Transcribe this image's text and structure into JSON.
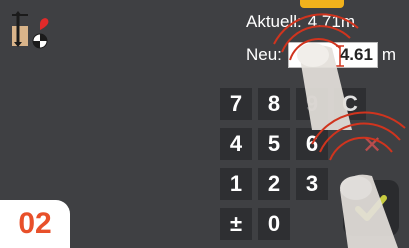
{
  "measure": {
    "current_label": "Aktuell:",
    "current_value": "4.71m",
    "new_label": "Neu:",
    "new_value": "4.61",
    "new_unit": "m"
  },
  "keypad": {
    "keys": [
      "7",
      "8",
      "9",
      "C",
      "4",
      "5",
      "6",
      "1",
      "2",
      "3",
      "±",
      "0"
    ]
  },
  "actions": {
    "cancel_icon": "✕",
    "confirm_icon": "✓"
  },
  "step": {
    "number": "02"
  },
  "colors": {
    "background": "#3f4043",
    "key_background": "#2e2f32",
    "step_number": "#e8502a",
    "cancel": "#b84d4d",
    "confirm": "#c8cc40",
    "touch_ring": "#d0341e",
    "top_tab": "#f2b21c"
  },
  "icons": {
    "app": "height-measure-icon",
    "cancel": "close-icon",
    "confirm": "check-icon"
  }
}
